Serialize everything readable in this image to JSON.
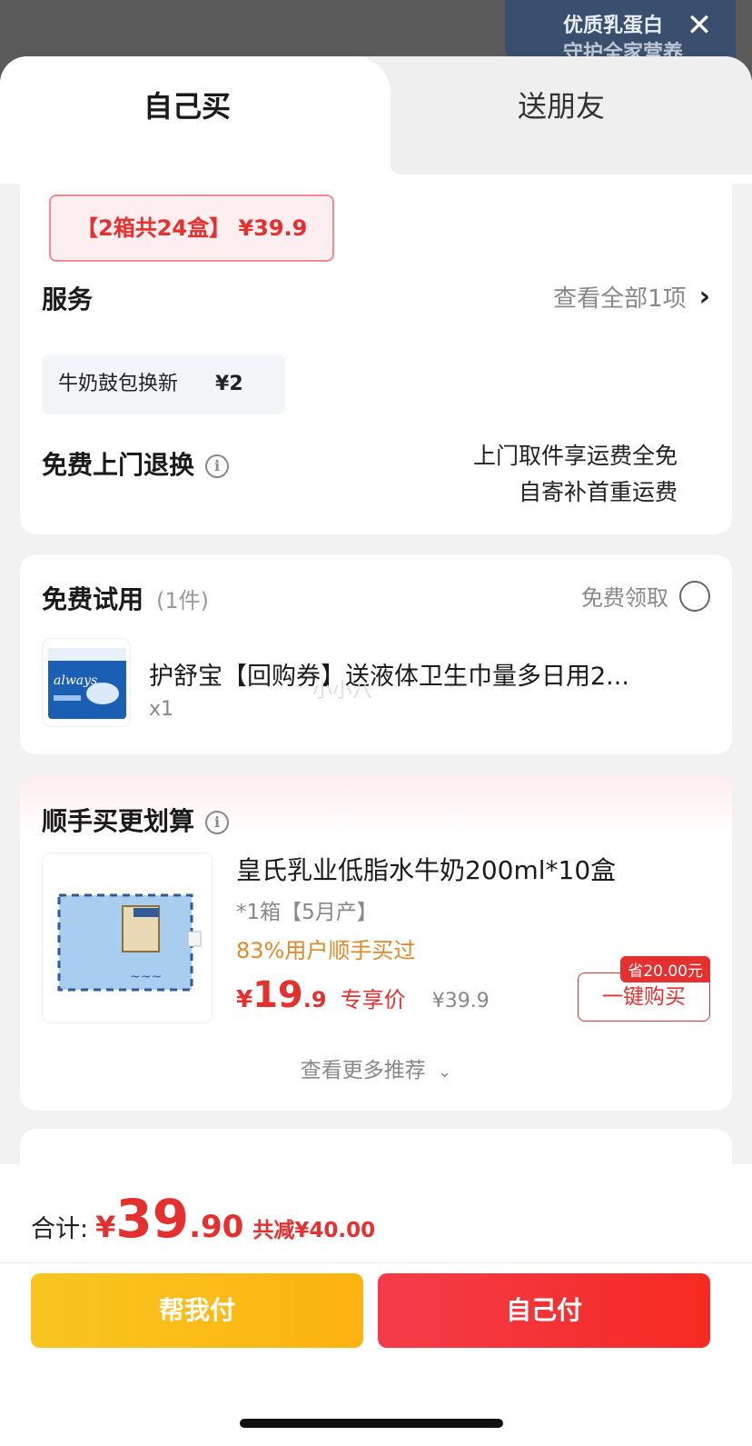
{
  "banner": {
    "line1": "优质乳蛋白",
    "line2": "守护全家营养"
  },
  "tabs": {
    "self": "自己买",
    "friend": "送朋友"
  },
  "spec": {
    "label": "【2箱共24盒】 ¥39.9"
  },
  "service": {
    "title": "服务",
    "more": "查看全部1项",
    "chip_name": "牛奶鼓包换新",
    "chip_price": "¥2",
    "return_title": "免费上门退换",
    "return_line1": "上门取件享运费全免",
    "return_line2": "自寄补首重运费"
  },
  "trial": {
    "title": "免费试用",
    "count": "(1件)",
    "claim": "免费领取",
    "product_name": "护舒宝【回购券】送液体卫生巾量多日用2...",
    "product_qty": "x1",
    "watermark": "小小八"
  },
  "addon": {
    "title": "顺手买更划算",
    "product_name": "皇氏乳业低脂水牛奶200ml*10盒",
    "spec": "*1箱【5月产】",
    "tag": "83%用户顺手买过",
    "price_cur": "¥",
    "price_int": "19",
    "price_dec": ".9",
    "price_label": "专享价",
    "orig_price": "¥39.9",
    "save_badge": "省20.00元",
    "buy_button": "一键购买",
    "more": "查看更多推荐"
  },
  "footer": {
    "total_label": "合计:",
    "total_cur": "¥",
    "total_int": "39",
    "total_dec": ".90",
    "discount": "共减¥40.00",
    "help_pay": "帮我付",
    "self_pay": "自己付"
  },
  "colors": {
    "accent": "#e4302e",
    "yellow": "#f8c520",
    "orange_tag": "#e0892a"
  },
  "icons": [
    "close-icon",
    "chevron-right-icon",
    "info-icon",
    "radio-icon",
    "chevron-down-icon"
  ]
}
